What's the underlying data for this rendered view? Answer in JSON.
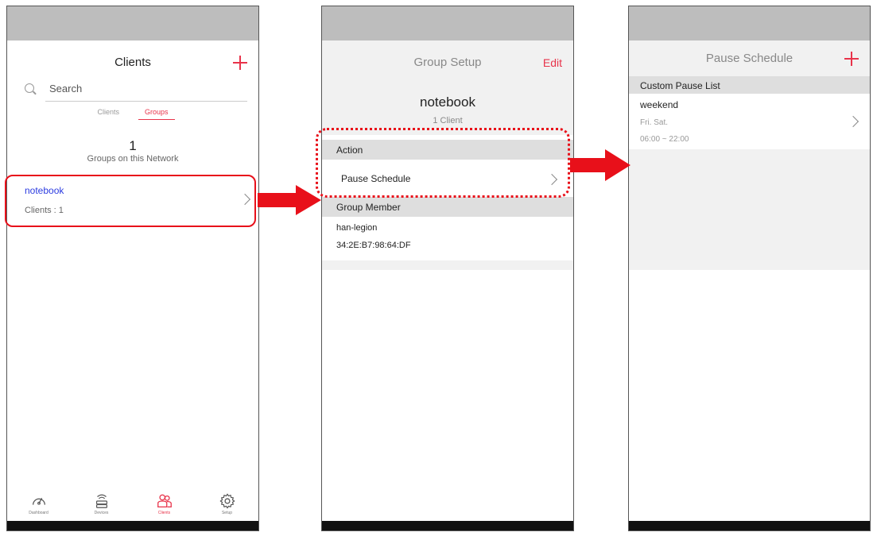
{
  "screen1": {
    "title": "Clients",
    "search_placeholder": "Search",
    "tabs": [
      "Clients",
      "Groups"
    ],
    "active_tab": "Groups",
    "group_count": "1",
    "group_count_label": "Groups on this Network",
    "groups": [
      {
        "name": "notebook",
        "clients_label": "Clients : 1"
      }
    ],
    "bottom_tabs": [
      {
        "label": "Dashboard",
        "icon": "speedometer-icon"
      },
      {
        "label": "Devices",
        "icon": "router-icon"
      },
      {
        "label": "Clients",
        "icon": "people-icon",
        "active": true
      },
      {
        "label": "Setup",
        "icon": "gear-icon"
      }
    ]
  },
  "screen2": {
    "title": "Group Setup",
    "edit_label": "Edit",
    "group_name": "notebook",
    "client_count": "1 Client",
    "action_section": "Action",
    "pause_schedule_label": "Pause Schedule",
    "member_section": "Group Member",
    "members": [
      {
        "name": "han-legion",
        "mac": "34:2E:B7:98:64:DF"
      }
    ]
  },
  "screen3": {
    "title": "Pause Schedule",
    "section_label": "Custom Pause List",
    "schedules": [
      {
        "name": "weekend",
        "days": "Fri. Sat.",
        "time": "06:00 ~ 22:00"
      }
    ]
  },
  "colors": {
    "accent": "#e8334a",
    "annotation_red": "#e8101a",
    "link_blue": "#2b3be0",
    "status_bar": "#bdbdbd"
  }
}
